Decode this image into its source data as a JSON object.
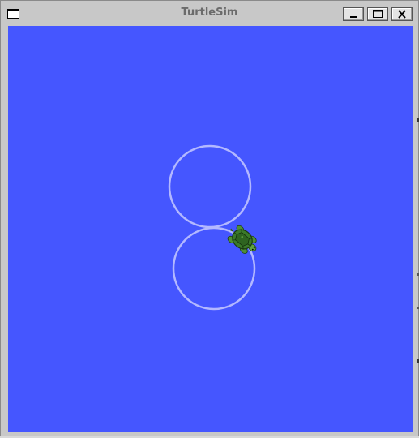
{
  "window": {
    "title": "TurtleSim",
    "window_icon": "window-menu-icon",
    "buttons": {
      "minimize": "minimize-icon",
      "maximize": "maximize-icon",
      "close": "close-icon"
    }
  },
  "canvas": {
    "background_color": "#4556ff",
    "pen_color": "#b3b8ff",
    "turtle_icon": "turtle-icon",
    "turtle_color": "#3b7a2a",
    "paths": [
      "upper-circle",
      "lower-circle"
    ]
  }
}
